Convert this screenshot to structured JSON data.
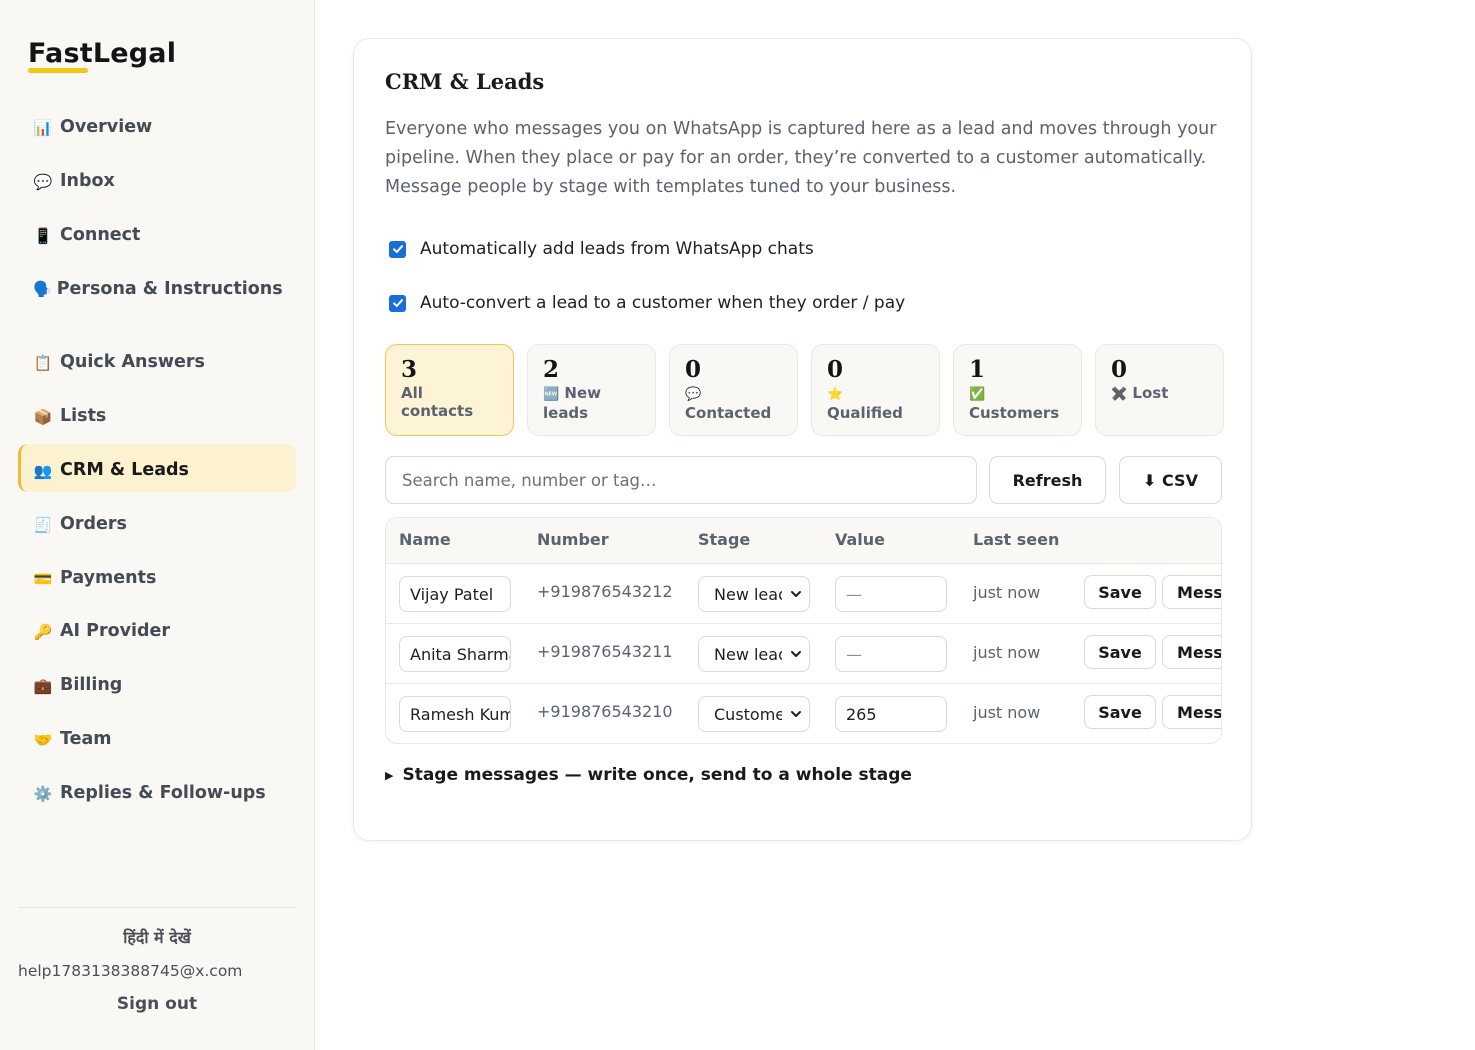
{
  "app": {
    "logo": "FastLegal",
    "accent": "#f5c518"
  },
  "sidebar": {
    "items": [
      {
        "icon": "📊",
        "icon_name": "chart-icon",
        "label": "Overview"
      },
      {
        "icon": "💬",
        "icon_name": "speech-bubble-icon",
        "label": "Inbox"
      },
      {
        "icon": "📱",
        "icon_name": "mobile-phone-icon",
        "label": "Connect"
      },
      {
        "icon": "🗣️",
        "icon_name": "speaking-head-icon",
        "label": "Persona & Instructions"
      },
      {
        "icon": "📋",
        "icon_name": "clipboard-icon",
        "label": "Quick Answers"
      },
      {
        "icon": "📦",
        "icon_name": "package-icon",
        "label": "Lists"
      },
      {
        "icon": "👥",
        "icon_name": "people-icon",
        "label": "CRM & Leads",
        "active": true
      },
      {
        "icon": "🧾",
        "icon_name": "receipt-icon",
        "label": "Orders"
      },
      {
        "icon": "💳",
        "icon_name": "credit-card-icon",
        "label": "Payments"
      },
      {
        "icon": "🔑",
        "icon_name": "key-icon",
        "label": "AI Provider"
      },
      {
        "icon": "💼",
        "icon_name": "briefcase-icon",
        "label": "Billing"
      },
      {
        "icon": "🤝",
        "icon_name": "handshake-icon",
        "label": "Team"
      },
      {
        "icon": "⚙️",
        "icon_name": "gear-icon",
        "label": "Replies & Follow-ups"
      }
    ],
    "footer": {
      "language_link": "हिंदी में देखें",
      "email": "help1783138388745@x.com",
      "sign_out": "Sign out"
    }
  },
  "main": {
    "title": "CRM & Leads",
    "description": "Everyone who messages you on WhatsApp is captured here as a lead and moves through your pipeline. When they place or pay for an order, they’re converted to a customer automatically. Message people by stage with templates tuned to your business.",
    "checkboxes": [
      {
        "label": "Automatically add leads from WhatsApp chats",
        "checked": true
      },
      {
        "label": "Auto-convert a lead to a customer when they order / pay",
        "checked": true
      }
    ],
    "stats": [
      {
        "count": "3",
        "emoji": "",
        "label": "All contacts",
        "active": true
      },
      {
        "count": "2",
        "emoji": "🆕",
        "label": "New leads"
      },
      {
        "count": "0",
        "emoji": "💬",
        "label": "Contacted"
      },
      {
        "count": "0",
        "emoji": "⭐",
        "label": "Qualified"
      },
      {
        "count": "1",
        "emoji": "✅",
        "label": "Customers"
      },
      {
        "count": "0",
        "emoji": "✖️",
        "label": "Lost"
      }
    ],
    "search": {
      "placeholder": "Search name, number or tag…",
      "value": ""
    },
    "refresh_label": "Refresh",
    "csv_label": "⬇ CSV",
    "table": {
      "columns": [
        "Name",
        "Number",
        "Stage",
        "Value",
        "Last seen"
      ],
      "rows": [
        {
          "name": "Vijay Patel",
          "number": "+919876543212",
          "stage": "New lead",
          "value": "—",
          "last_seen": "just now",
          "save": "Save",
          "message": "Message"
        },
        {
          "name": "Anita Sharma",
          "number": "+919876543211",
          "stage": "New lead",
          "value": "—",
          "last_seen": "just now",
          "save": "Save",
          "message": "Message"
        },
        {
          "name": "Ramesh Kumar",
          "number": "+919876543210",
          "stage": "Customer",
          "value": "265",
          "last_seen": "just now",
          "save": "Save",
          "message": "Message"
        }
      ]
    },
    "stage_messages_summary": "Stage messages — write once, send to a whole stage"
  }
}
